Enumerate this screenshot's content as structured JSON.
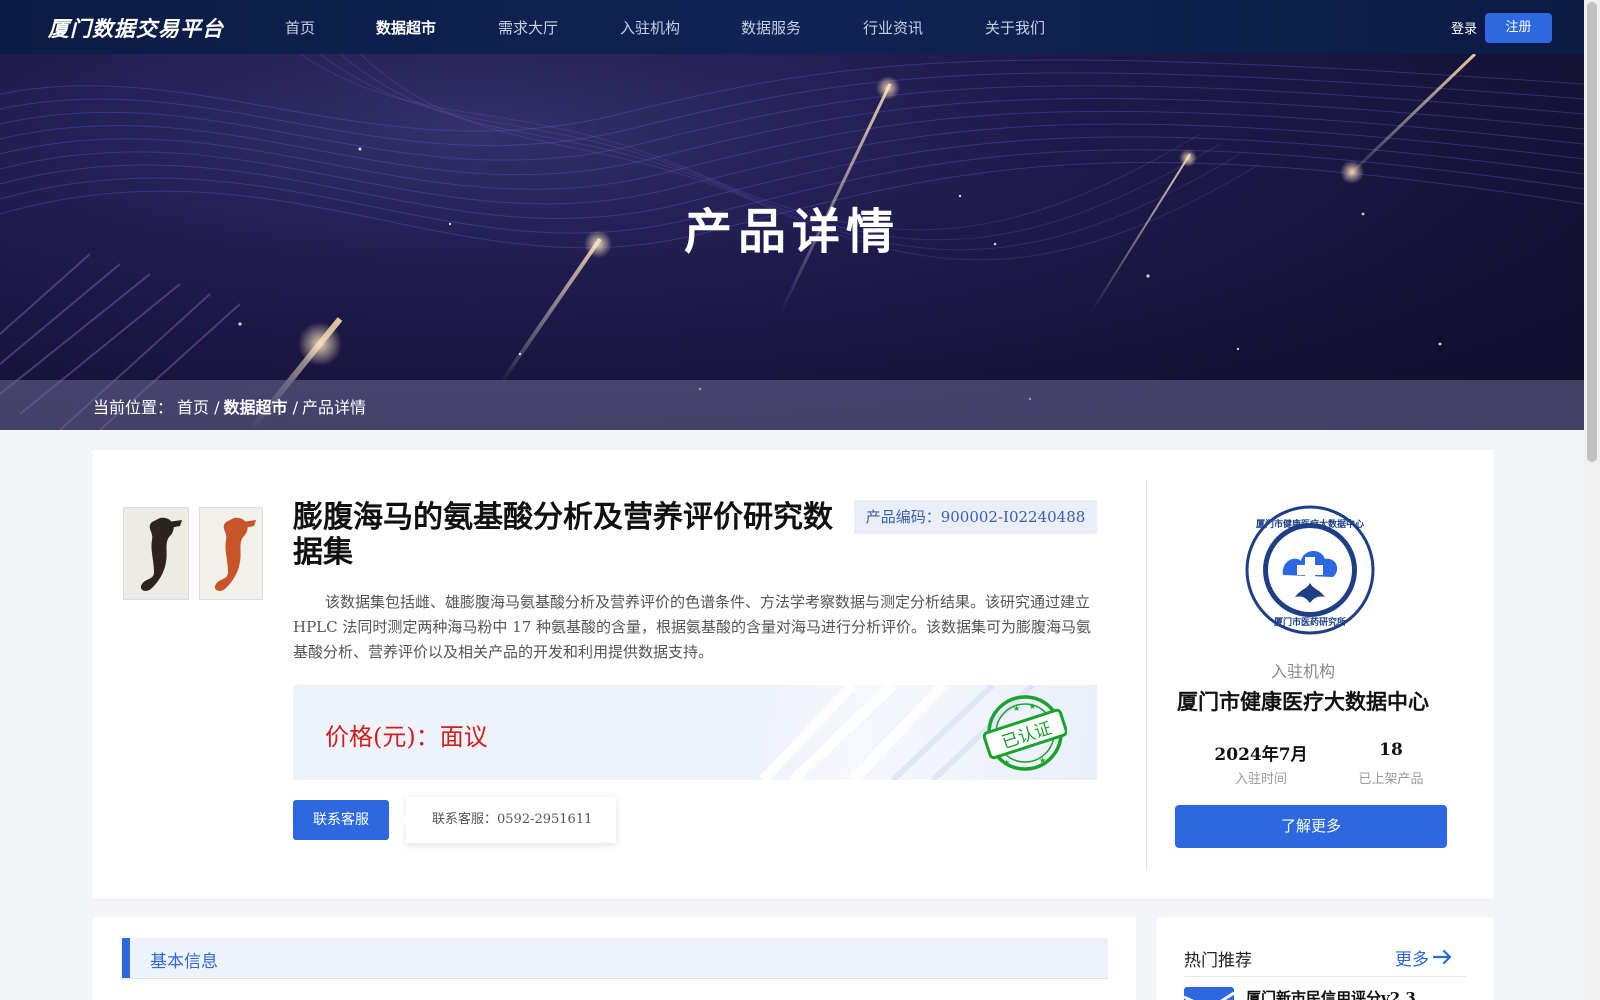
{
  "nav": {
    "logo": "厦门数据交易平台",
    "items": [
      "首页",
      "数据超市",
      "需求大厅",
      "入驻机构",
      "数据服务",
      "行业资讯",
      "关于我们"
    ],
    "active_index": 1,
    "login": "登录",
    "register": "注册"
  },
  "banner": {
    "title": "产品详情"
  },
  "breadcrumb": {
    "prefix": "当前位置：",
    "home": "首页",
    "sep1": "/",
    "category": "数据超市",
    "sep2": "/",
    "current": "产品详情"
  },
  "product": {
    "title": "膨腹海马的氨基酸分析及营养评价研究数据集",
    "code_label": "产品编码：",
    "code_value": "900002-I02240488",
    "description": "该数据集包括雌、雄膨腹海马氨基酸分析及营养评价的色谱条件、方法学考察数据与测定分析结果。该研究通过建立 HPLC 法同时测定两种海马粉中 17 种氨基酸的含量，根据氨基酸的含量对海马进行分析评价。该数据集可为膨腹海马氨基酸分析、营养评价以及相关产品的开发和利用提供数据支持。",
    "price_label": "价格(元)：面议",
    "certified": "已认证",
    "contact_button": "联系客服",
    "contact_tooltip": "联系客服：0592-2951611"
  },
  "org": {
    "role": "入驻机构",
    "name": "厦门市健康医疗大数据中心",
    "logo_top_text": "厦门市健康医疗大数据中心",
    "logo_bottom_text": "厦门市医药研究所",
    "joined_value": "2024年7月",
    "joined_label": "入驻时间",
    "products_value": "18",
    "products_label": "已上架产品",
    "learn_more": "了解更多"
  },
  "basic_info": {
    "title": "基本信息"
  },
  "hot": {
    "title": "热门推荐",
    "more": "更多",
    "first_item": "厦门新市民信用评分v2.3"
  },
  "colors": {
    "accent": "#2d68e0",
    "nav_bg": "#0b1b44",
    "price_red": "#d41e1e",
    "stamp_green": "#19a32c"
  }
}
